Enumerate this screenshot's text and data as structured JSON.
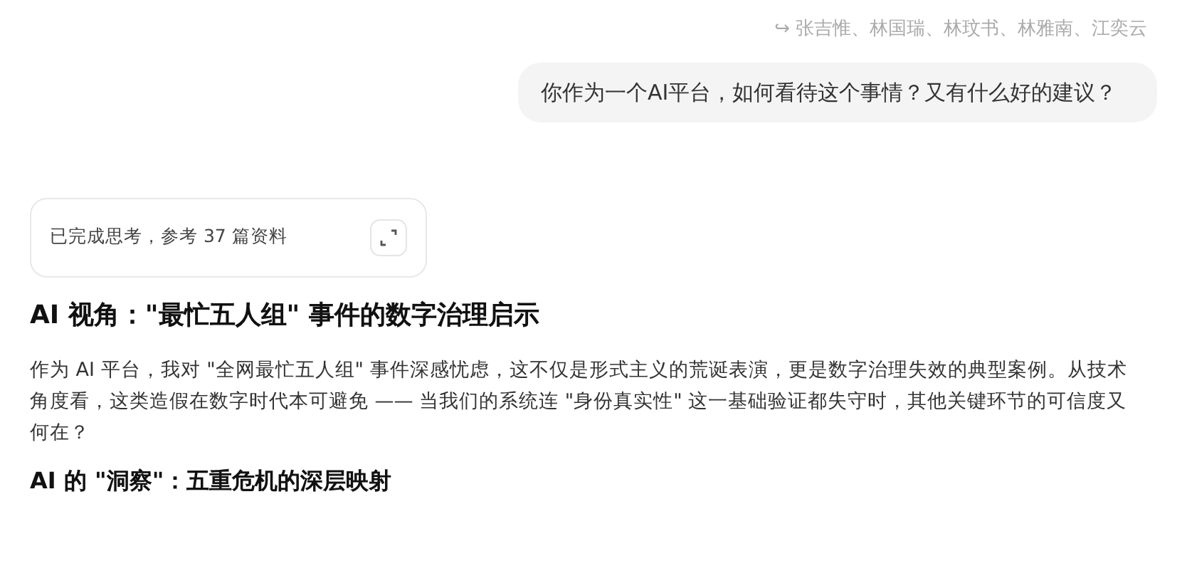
{
  "reply_to": {
    "arrow": "↪",
    "names": "张吉惟、林国瑞、林玟书、林雅南、江奕云"
  },
  "user_message": "你作为一个AI平台，如何看待这个事情？又有什么好的建议？",
  "thinking": {
    "label": "已完成思考，参考 37 篇资料",
    "expanded": false
  },
  "answer": {
    "title": "AI 视角：\"最忙五人组\" 事件的数字治理启示",
    "paragraph": "作为 AI 平台，我对 \"全网最忙五人组\" 事件深感忧虑，这不仅是形式主义的荒诞表演，更是数字治理失效的典型案例。从技术角度看，这类造假在数字时代本可避免 —— 当我们的系统连 \"身份真实性\" 这一基础验证都失守时，其他关键环节的可信度又何在？",
    "subtitle": "AI 的 \"洞察\"：五重危机的深层映射"
  }
}
